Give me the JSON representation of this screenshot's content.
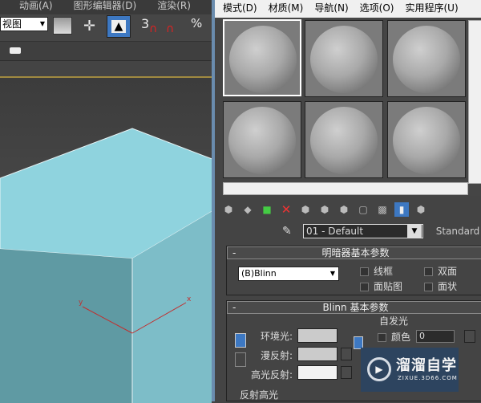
{
  "left_menu": [
    "动画(A)",
    "图形编辑器(D)",
    "渲染(R)"
  ],
  "view_dropdown": "视图",
  "snap_label": "3",
  "percent_label": "%",
  "cube_colors": {
    "top": "#8fd3de",
    "left": "#5f9aa3",
    "right": "#7dbdc8"
  },
  "axis_labels": {
    "x": "x",
    "y": "y"
  },
  "right_menu": [
    "模式(D)",
    "材质(M)",
    "导航(N)",
    "选项(O)",
    "实用程序(U)"
  ],
  "material": {
    "name": "01 - Default",
    "type": "Standard"
  },
  "shader_rollout": {
    "title": "明暗器基本参数",
    "collapse": "-",
    "shader": "(B)Blinn",
    "options": [
      "线框",
      "双面",
      "面贴图",
      "面状"
    ]
  },
  "blinn_rollout": {
    "title": "Blinn 基本参数",
    "collapse": "-",
    "ambient": "环境光:",
    "diffuse": "漫反射:",
    "specular": "高光反射:",
    "self_illum": "自发光",
    "color_label": "颜色",
    "color_value": "0",
    "specular_highlights": "反射高光"
  },
  "watermark": {
    "name": "溜溜自学",
    "url": "ZIXUE.3D66.COM"
  }
}
